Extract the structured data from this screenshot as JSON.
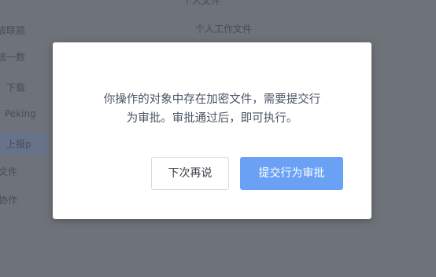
{
  "background": {
    "left_items": [
      "放联题",
      "统一数",
      "下载",
      "Peking",
      "上报p",
      "文件",
      "协作"
    ],
    "right_items": [
      "个人文件",
      "个人工作文件"
    ]
  },
  "dialog": {
    "message_line1": "你操作的对象中存在加密文件，需要提交行",
    "message_line2": "为审批。审批通过后，即可执行。",
    "cancel_label": "下次再说",
    "confirm_label": "提交行为审批"
  },
  "colors": {
    "primary": "#6aa1f5",
    "overlay": "#7f838a",
    "text": "#4b5463"
  }
}
